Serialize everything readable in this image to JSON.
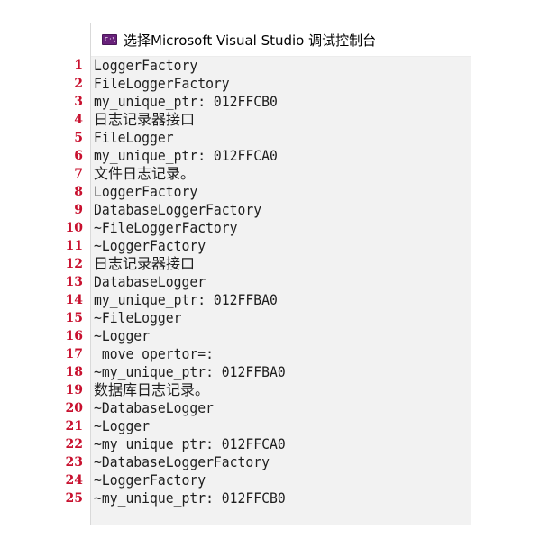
{
  "window": {
    "icon": "console-app-icon",
    "title": "选择Microsoft Visual Studio 调试控制台"
  },
  "line_numbers": [
    "1",
    "2",
    "3",
    "4",
    "5",
    "6",
    "7",
    "8",
    "9",
    "10",
    "11",
    "12",
    "13",
    "14",
    "15",
    "16",
    "17",
    "18",
    "19",
    "20",
    "21",
    "22",
    "23",
    "24",
    "25"
  ],
  "colors": {
    "line_number": "#c8102e",
    "console_background": "#f2f2f2",
    "console_text": "#1e1e1e"
  },
  "console": {
    "lines": [
      "LoggerFactory",
      "FileLoggerFactory",
      "my_unique_ptr: 012FFCB0",
      "日志记录器接口",
      "FileLogger",
      "my_unique_ptr: 012FFCA0",
      "文件日志记录。",
      "LoggerFactory",
      "DatabaseLoggerFactory",
      "~FileLoggerFactory",
      "~LoggerFactory",
      "日志记录器接口",
      "DatabaseLogger",
      "my_unique_ptr: 012FFBA0",
      "~FileLogger",
      "~Logger",
      " move opertor=:",
      "~my_unique_ptr: 012FFBA0",
      "数据库日志记录。",
      "~DatabaseLogger",
      "~Logger",
      "~my_unique_ptr: 012FFCA0",
      "~DatabaseLoggerFactory",
      "~LoggerFactory",
      "~my_unique_ptr: 012FFCB0"
    ]
  }
}
